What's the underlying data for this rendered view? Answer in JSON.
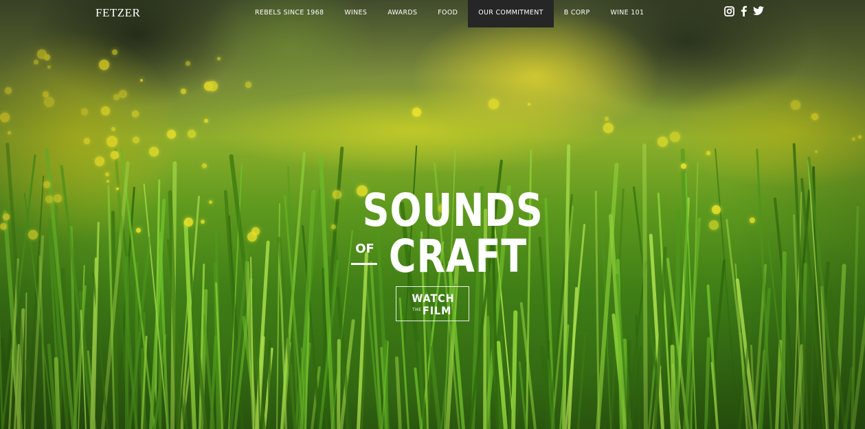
{
  "brand": {
    "logo_text": "FETZER"
  },
  "nav": {
    "items": [
      {
        "label": "REBELS SINCE 1968",
        "active": false
      },
      {
        "label": "WINES",
        "active": false
      },
      {
        "label": "AWARDS",
        "active": false
      },
      {
        "label": "FOOD",
        "active": false
      },
      {
        "label": "OUR COMMITMENT",
        "active": true
      },
      {
        "label": "B CORP",
        "active": false
      },
      {
        "label": "WINE 101",
        "active": false
      }
    ]
  },
  "social": {
    "icons": [
      "instagram-icon",
      "facebook-icon",
      "twitter-icon"
    ]
  },
  "hero": {
    "title_line1": "SOUNDS",
    "title_of": "OF",
    "title_line2": "CRAFT",
    "cta_line1": "WATCH",
    "cta_the": "THE",
    "cta_line2": "FILM"
  },
  "colors": {
    "nav_active_bg": "#262626",
    "text": "#ffffff",
    "grass_dark": "#2d5e10",
    "flower_yellow": "#e8e02a"
  }
}
